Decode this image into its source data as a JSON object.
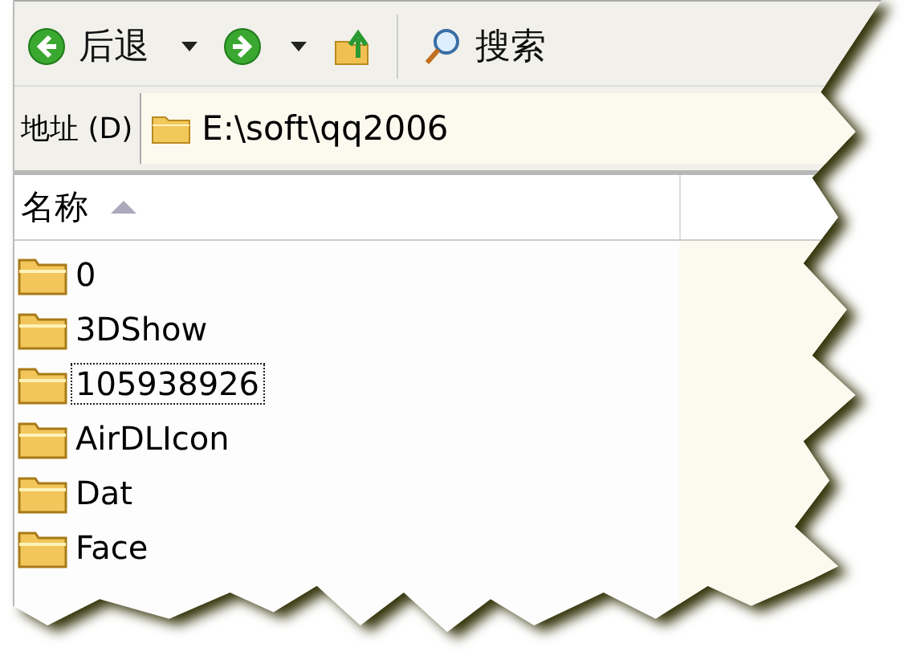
{
  "toolbar": {
    "back_label": "后退",
    "search_label": "搜索"
  },
  "address_bar": {
    "label": "地址 (D)",
    "value": "E:\\soft\\qq2006"
  },
  "list": {
    "columns": [
      {
        "label": "名称",
        "sorted": true
      }
    ],
    "items": [
      {
        "name": "0",
        "focused": false
      },
      {
        "name": "3DShow",
        "focused": false
      },
      {
        "name": "105938926",
        "focused": true
      },
      {
        "name": "AirDLIcon",
        "focused": false
      },
      {
        "name": "Dat",
        "focused": false
      },
      {
        "name": "Face",
        "focused": false
      }
    ]
  }
}
